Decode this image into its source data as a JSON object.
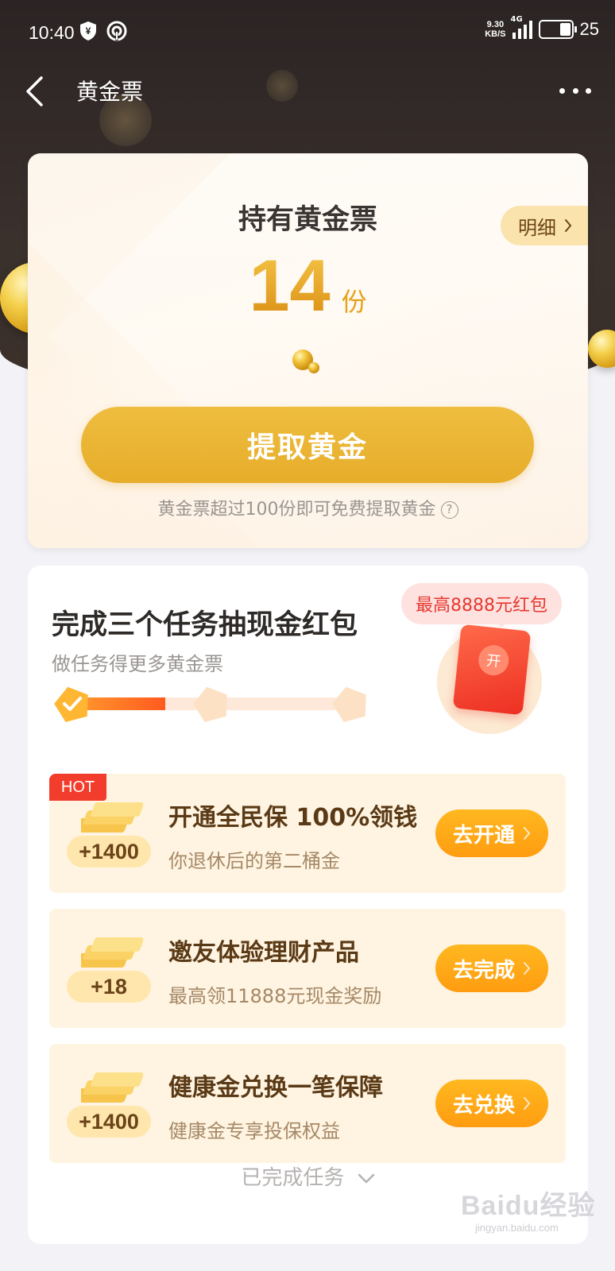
{
  "status_bar": {
    "time": "10:40",
    "speed_value": "9.30",
    "speed_unit": "KB/S",
    "network": "4G",
    "battery": "25"
  },
  "nav": {
    "title": "黄金票"
  },
  "gold_card": {
    "title": "持有黄金票",
    "count": "14",
    "unit": "份",
    "detail_label": "明细",
    "extract_label": "提取黄金",
    "hint": "黄金票超过100份即可免费提取黄金"
  },
  "tasks": {
    "title": "完成三个任务抽现金红包",
    "subtitle": "做任务得更多黄金票",
    "badge": "最高8888元红包",
    "envelope_label": "开",
    "progress_completed": 1,
    "progress_total": 3,
    "items": [
      {
        "tag": "HOT",
        "reward": "+1400",
        "title": "开通全民保 100%领钱",
        "desc": "你退休后的第二桶金",
        "action": "去开通"
      },
      {
        "reward": "+18",
        "title": "邀友体验理财产品",
        "desc": "最高领11888元现金奖励",
        "action": "去完成"
      },
      {
        "reward": "+1400",
        "title": "健康金兑换一笔保障",
        "desc": "健康金专享投保权益",
        "action": "去兑换"
      }
    ],
    "completed_label": "已完成任务"
  },
  "watermark": {
    "text": "Baidu经验",
    "sub": "jingyan.baidu.com"
  },
  "colors": {
    "accent_gold": "#e6ad2a",
    "accent_orange": "#ff9c10",
    "hot_red": "#f23c2c"
  }
}
